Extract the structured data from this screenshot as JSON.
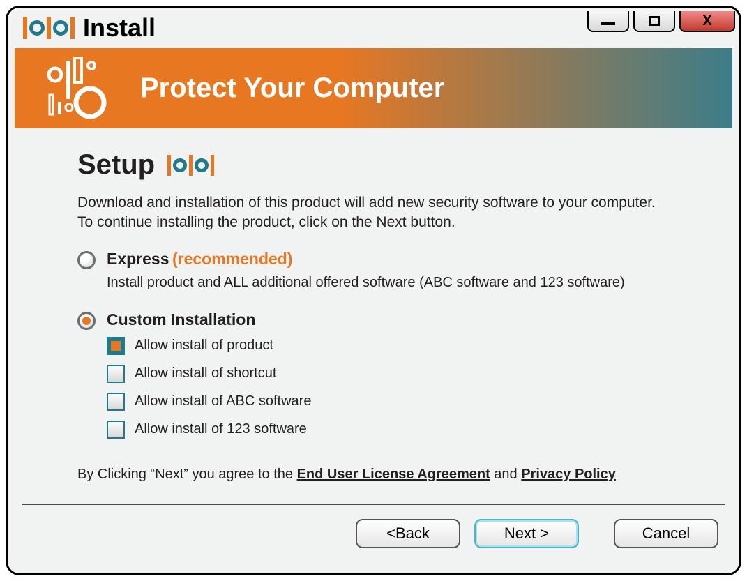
{
  "window": {
    "title": "Install"
  },
  "banner": {
    "title": "Protect Your Computer"
  },
  "setup": {
    "heading": "Setup",
    "description": "Download and installation of this product will add new security software to your computer. To continue installing the product, click on the Next button."
  },
  "options": {
    "express": {
      "label": "Express",
      "recommended": "(recommended)",
      "sub": "Install product and ALL additional offered software (ABC software and 123 software)",
      "selected": false
    },
    "custom": {
      "label": "Custom Installation",
      "selected": true,
      "checks": [
        {
          "label": "Allow install of product",
          "checked": true
        },
        {
          "label": "Allow install of shortcut",
          "checked": false
        },
        {
          "label": "Allow install of ABC software",
          "checked": false
        },
        {
          "label": "Allow install of 123 software",
          "checked": false
        }
      ]
    }
  },
  "agreement": {
    "prefix": "By Clicking “Next” you agree to the ",
    "eula": "End User License Agreement",
    "mid": " and ",
    "privacy": "Privacy Policy"
  },
  "footer": {
    "back": "<Back",
    "next": "Next >",
    "cancel": "Cancel"
  }
}
